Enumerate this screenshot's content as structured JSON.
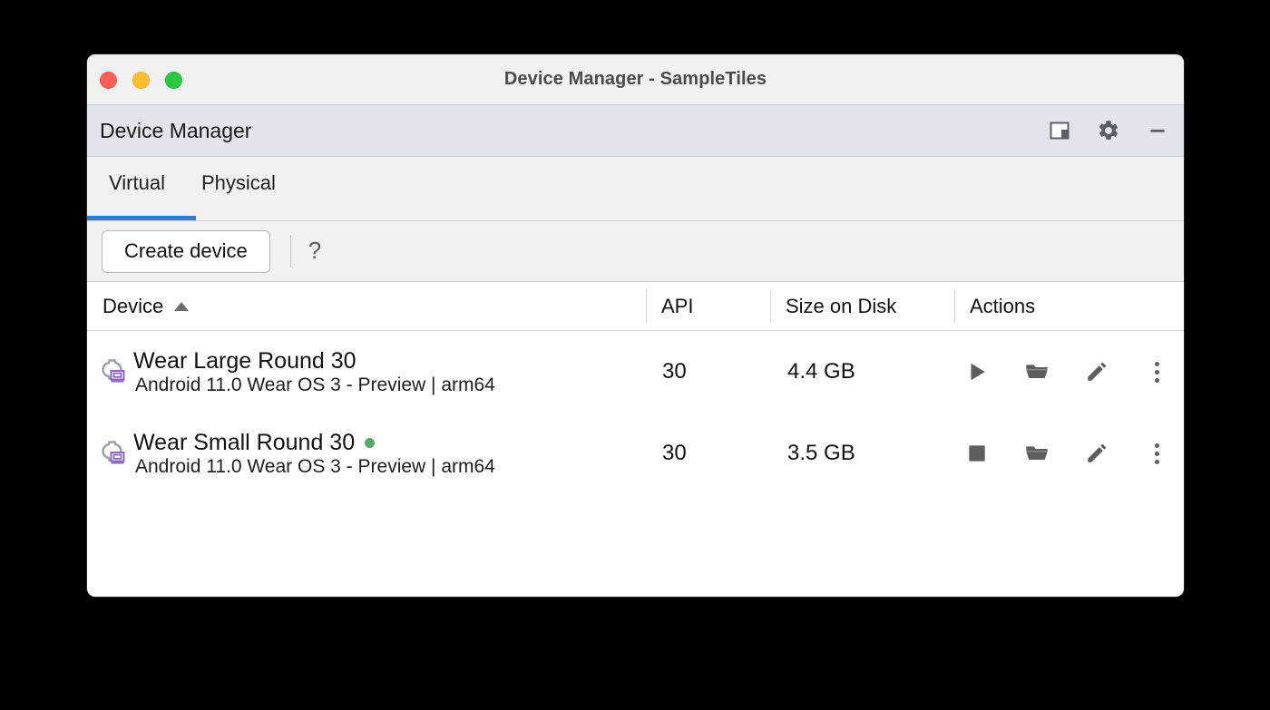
{
  "window": {
    "title": "Device Manager - SampleTiles",
    "traffic_lights": [
      {
        "name": "close",
        "color": "#ff5f57"
      },
      {
        "name": "minimize",
        "color": "#febc2e"
      },
      {
        "name": "zoom",
        "color": "#28c840"
      }
    ]
  },
  "tool_window": {
    "title": "Device Manager",
    "actions": [
      {
        "name": "layout-panel-icon",
        "label": ""
      },
      {
        "name": "gear-icon",
        "label": ""
      },
      {
        "name": "minimize-icon",
        "label": ""
      }
    ]
  },
  "tabs": {
    "items": [
      {
        "label": "Virtual",
        "active": true
      },
      {
        "label": "Physical",
        "active": false
      }
    ],
    "accent_color": "#3b78c2"
  },
  "toolbar": {
    "create_label": "Create device",
    "help_label": "?"
  },
  "table": {
    "columns": [
      {
        "label": "Device",
        "sorted": "asc"
      },
      {
        "label": "API"
      },
      {
        "label": "Size on Disk"
      },
      {
        "label": "Actions"
      }
    ],
    "rows": [
      {
        "device_name": "Wear Large Round 30",
        "device_detail": "Android 11.0 Wear OS 3 - Preview | arm64",
        "running": false,
        "api": "30",
        "size_on_disk": "4.4 GB",
        "primary_action": "play",
        "actions": [
          "play-icon",
          "folder-open-icon",
          "edit-pencil-icon",
          "overflow-menu-icon"
        ]
      },
      {
        "device_name": "Wear Small Round 30",
        "device_detail": "Android 11.0 Wear OS 3 - Preview | arm64",
        "running": true,
        "api": "30",
        "size_on_disk": "3.5 GB",
        "primary_action": "stop",
        "actions": [
          "stop-icon",
          "folder-open-icon",
          "edit-pencil-icon",
          "overflow-menu-icon"
        ]
      }
    ],
    "running_dot_color": "#59a869"
  }
}
